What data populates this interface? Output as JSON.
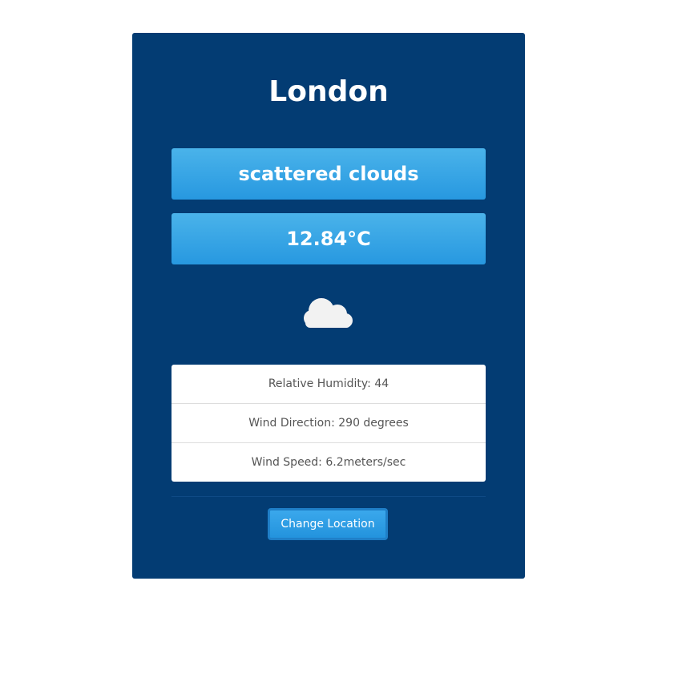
{
  "location": {
    "city": "London"
  },
  "weather": {
    "description": "scattered clouds",
    "temperature": "12.84°C",
    "icon": "cloud-icon"
  },
  "details": [
    {
      "text": "Relative Humidity: 44"
    },
    {
      "text": "Wind Direction: 290 degrees"
    },
    {
      "text": "Wind Speed: 6.2meters/sec"
    }
  ],
  "actions": {
    "change_location_label": "Change Location"
  },
  "colors": {
    "card_background": "#033c73",
    "pill_accent": "#2798e0",
    "icon_color": "#f2f2f2"
  }
}
